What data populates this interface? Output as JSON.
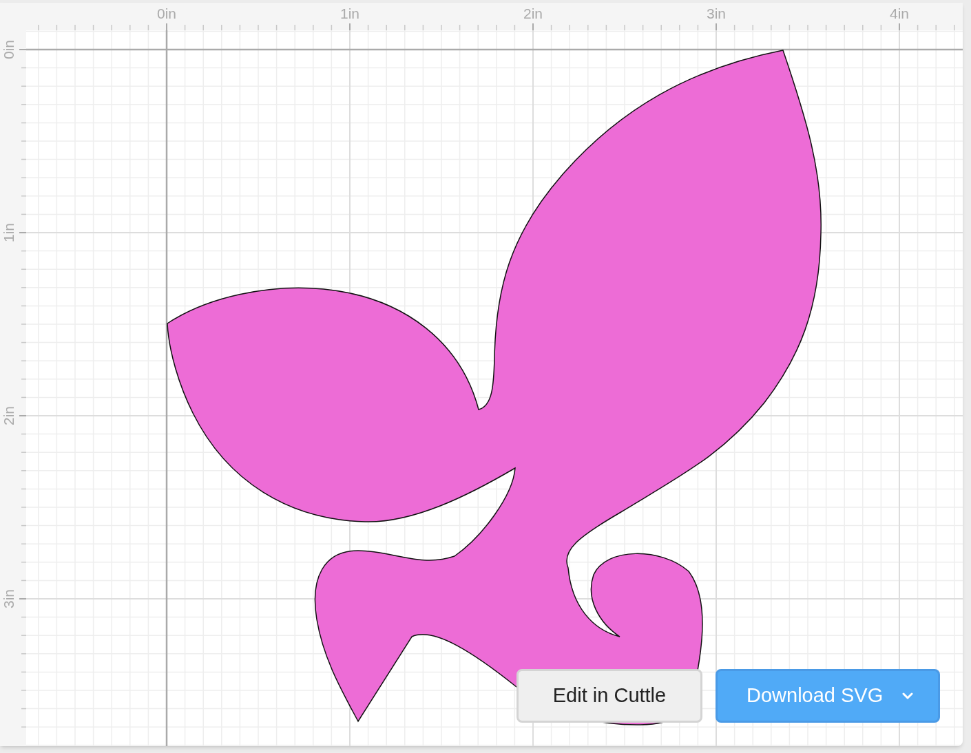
{
  "rulers": {
    "horizontal": [
      "0in",
      "1in",
      "2in",
      "3in",
      "4in"
    ],
    "vertical": [
      "0in",
      "1in",
      "2in",
      "3in"
    ]
  },
  "buttons": {
    "edit": "Edit in Cuttle",
    "download": "Download SVG"
  }
}
